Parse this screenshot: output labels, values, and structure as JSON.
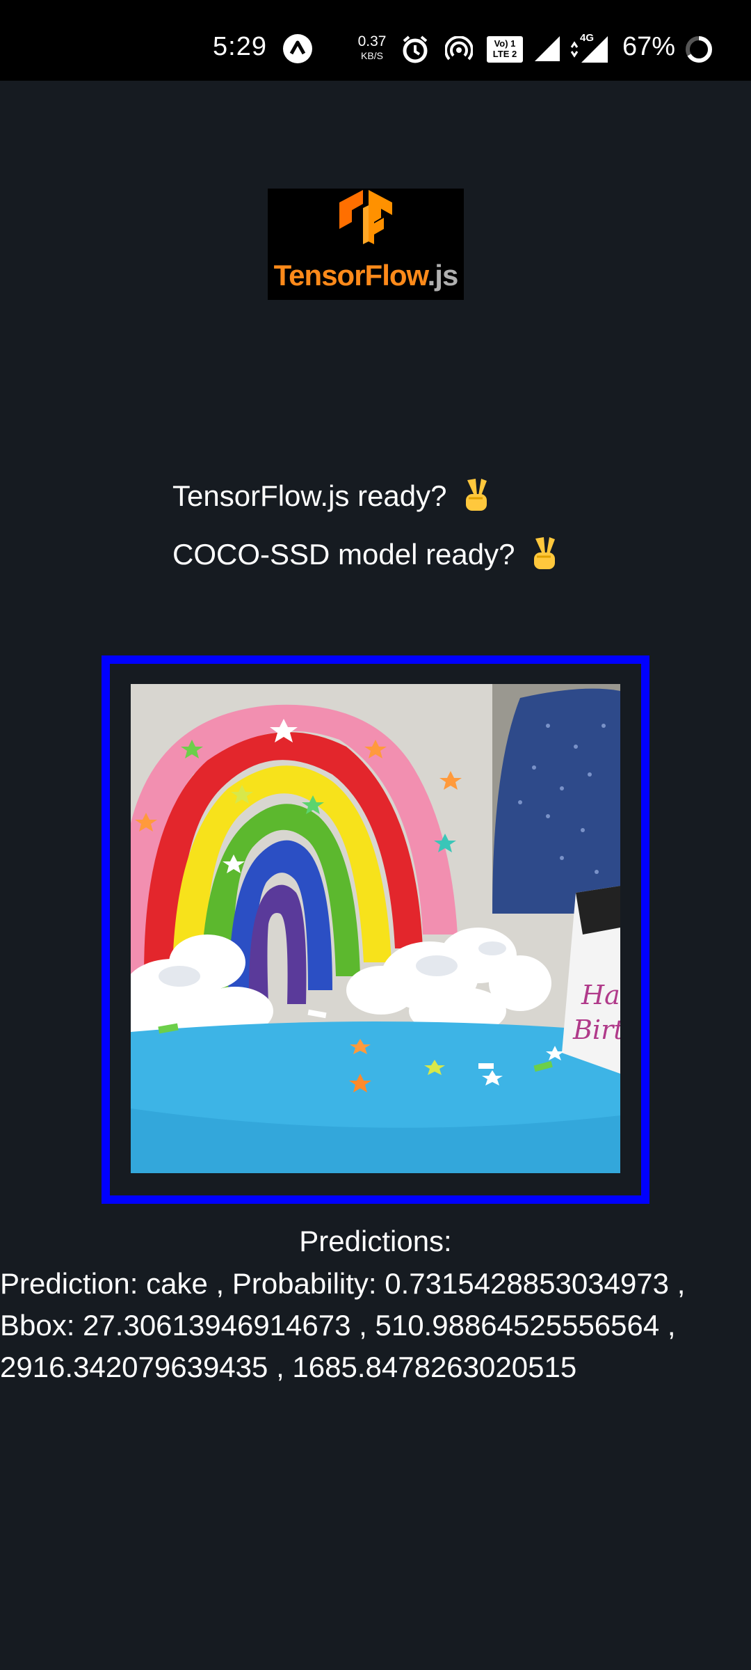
{
  "status_bar": {
    "time": "5:29",
    "net_speed_value": "0.37",
    "net_speed_unit": "KB/S",
    "volte_label_top": "Vo) 1",
    "volte_label_bottom": "LTE 2",
    "network_type": "4G",
    "battery_percent": "67%",
    "icons": [
      "app-notification-icon",
      "alarm-icon",
      "hotspot-icon",
      "volte-icon",
      "signal-icon",
      "signal-4g-icon",
      "battery-ring-icon"
    ]
  },
  "logo": {
    "word_main": "TensorFlow",
    "word_suffix": ".js",
    "colors": {
      "orange": "#ff8a1a",
      "gray": "#b0b0b0",
      "background": "#000000"
    }
  },
  "status": {
    "tf_ready": "TensorFlow.js ready?",
    "coco_ready": "COCO-SSD model ready?",
    "ready_icon": "victory-hand-icon"
  },
  "image": {
    "frame_color": "#0000ff",
    "photo_alt": "rainbow cake"
  },
  "predictions": {
    "title": "Predictions:",
    "text": "Prediction: cake ,  Probability: 0.7315428853034973 ,  Bbox: 27.30613946914673 ,  510.98864525556564 ,  2916.342079639435 ,  1685.8478263020515"
  }
}
